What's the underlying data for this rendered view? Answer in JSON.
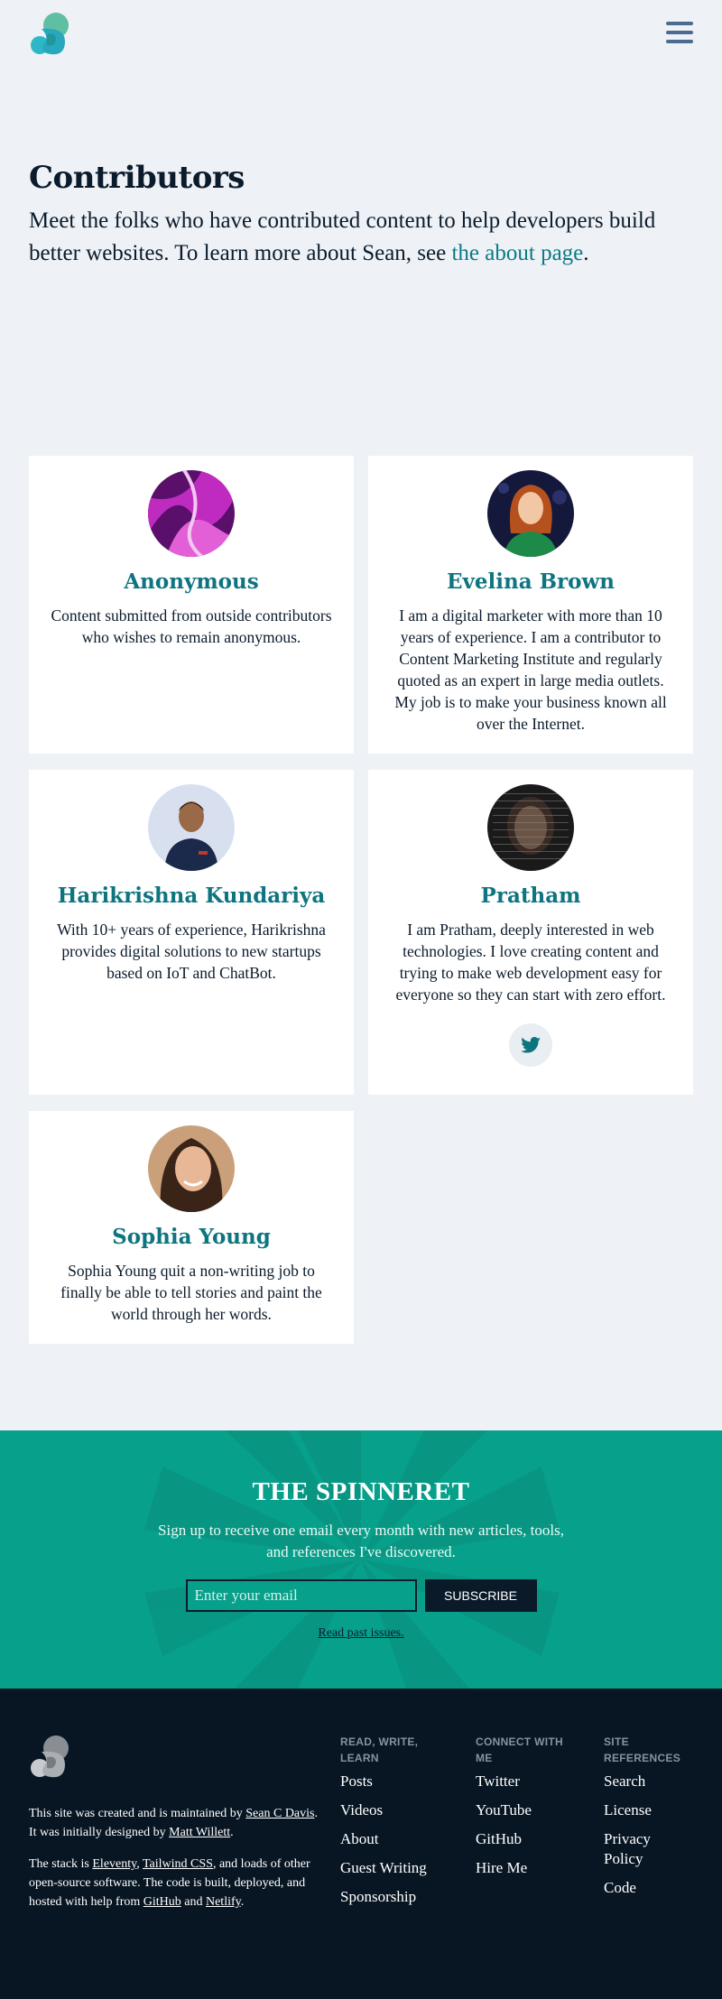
{
  "header": {
    "logo_icon": "spinneret-logo-icon",
    "menu_icon": "hamburger-menu-icon"
  },
  "intro": {
    "title": "Contributors",
    "text_before": "Meet the folks who have contributed content to help developers build better websites. To learn more about Sean, see ",
    "link_text": "the about page",
    "text_after": "."
  },
  "contributors": [
    {
      "name": "Anonymous",
      "bio": "Content submitted from outside contributors who wishes to remain anonymous."
    },
    {
      "name": "Evelina Brown",
      "bio": "I am a digital marketer with more than 10 years of experience. I am a contributor to Content Marketing Institute and regularly quoted as an expert in large media outlets. My job is to make your business known all over the Internet."
    },
    {
      "name": "Harikrishna Kundariya",
      "bio": "With 10+ years of experience, Harikrishna provides digital solutions to new startups based on IoT and ChatBot."
    },
    {
      "name": "Pratham",
      "bio": "I am Pratham, deeply interested in web technologies. I love creating content and trying to make web development easy for everyone so they can start with zero effort.",
      "social_icon": "twitter-icon"
    },
    {
      "name": "Sophia Young",
      "bio": "Sophia Young quit a non-writing job to finally be able to tell stories and paint the world through her words."
    }
  ],
  "newsletter": {
    "title": "THE SPINNERET",
    "description": "Sign up to receive one email every month with new articles, tools, and references I've discovered.",
    "email_placeholder": "Enter your email",
    "subscribe_label": "SUBSCRIBE",
    "past_issues_link": "Read past issues."
  },
  "footer": {
    "about": {
      "p1_a": "This site was created and is maintained by ",
      "p1_link1": "Sean C Davis",
      "p1_b": ". It was initially designed by ",
      "p1_link2": "Matt Willett",
      "p1_c": ".",
      "p2_a": "The stack is ",
      "p2_link1": "Eleventy",
      "p2_b": ", ",
      "p2_link2": "Tailwind CSS",
      "p2_c": ", and loads of other open-source software. The code is built, deployed, and hosted with help from ",
      "p2_link3": "GitHub",
      "p2_d": " and ",
      "p2_link4": "Netlify",
      "p2_e": "."
    },
    "columns": [
      {
        "heading": "READ, WRITE, LEARN",
        "links": [
          "Posts",
          "Videos",
          "About",
          "Guest Writing",
          "Sponsorship"
        ]
      },
      {
        "heading": "CONNECT WITH ME",
        "links": [
          "Twitter",
          "YouTube",
          "GitHub",
          "Hire Me"
        ]
      },
      {
        "heading": "SITE REFERENCES",
        "links": [
          "Search",
          "License",
          "Privacy Policy",
          "Code"
        ]
      }
    ]
  },
  "colors": {
    "background": "#eef1f6",
    "accent_teal": "#0e7580",
    "newsletter_bg": "#07a08b",
    "footer_bg": "#081623"
  }
}
